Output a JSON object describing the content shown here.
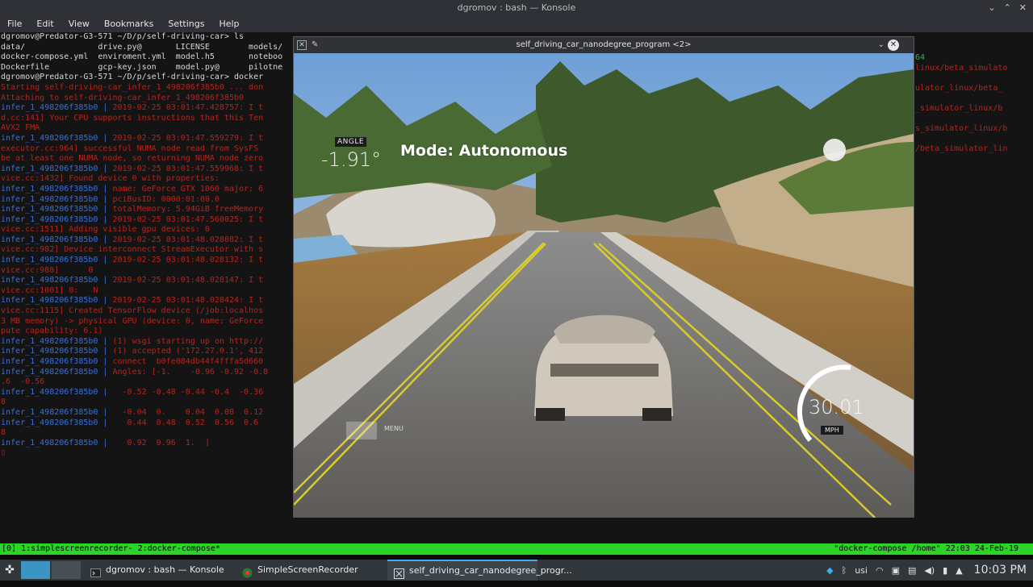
{
  "konsole": {
    "title": "dgromov : bash — Konsole",
    "menu": [
      "File",
      "Edit",
      "View",
      "Bookmarks",
      "Settings",
      "Help"
    ],
    "lines": [
      {
        "t": "dgromov@Predator-G3-571 ~/D/p/self-driving-car> ls",
        "c": "white"
      },
      {
        "t": "data/               drive.py@       LICENSE        models/",
        "c": "white"
      },
      {
        "t": "docker-compose.yml  enviroment.yml  model.h5       noteboo",
        "c": "white"
      },
      {
        "t": "Dockerfile          gcp-key.json    model.py@      pilotne",
        "c": "white"
      },
      {
        "t": "dgromov@Predator-G3-571 ~/D/p/self-driving-car> docker",
        "c": "white"
      },
      {
        "t": "Starting self-driving-car_infer_1_498206f385b0 ... don",
        "c": "red"
      },
      {
        "t": "Attaching to self-driving-car_infer_1_498206f385b0",
        "c": "red"
      },
      {
        "t": "infer_1_498206f385b0 | 2019-02-25 03:01:47.428757: I t",
        "c": "mix"
      },
      {
        "t": "d.cc:141] Your CPU supports instructions that this Ten",
        "c": "red"
      },
      {
        "t": "AVX2 FMA",
        "c": "red"
      },
      {
        "t": "infer_1_498206f385b0 | 2019-02-25 03:01:47.559279: I t",
        "c": "mix"
      },
      {
        "t": "executor.cc:964] successful NUMA node read from SysFS",
        "c": "red"
      },
      {
        "t": "be at least one NUMA node, so returning NUMA node zero",
        "c": "red"
      },
      {
        "t": "infer_1_498206f385b0 | 2019-02-25 03:01:47.559968: I t",
        "c": "mix"
      },
      {
        "t": "vice.cc:1432] Found device 0 with properties:",
        "c": "red"
      },
      {
        "t": "infer_1_498206f385b0 | name: GeForce GTX 1060 major: 6",
        "c": "mix"
      },
      {
        "t": "infer_1_498206f385b0 | pciBusID: 0000:01:00.0",
        "c": "mix"
      },
      {
        "t": "infer_1_498206f385b0 | totalMemory: 5.94GiB freeMemory",
        "c": "mix"
      },
      {
        "t": "infer_1_498206f385b0 | 2019-02-25 03:01:47.560025: I t",
        "c": "mix"
      },
      {
        "t": "vice.cc:1511] Adding visible gpu devices: 0",
        "c": "red"
      },
      {
        "t": "infer_1_498206f385b0 | 2019-02-25 03:01:48.028082: I t",
        "c": "mix"
      },
      {
        "t": "vice.cc:982] Device interconnect StreamExecutor with s",
        "c": "red"
      },
      {
        "t": "infer_1_498206f385b0 | 2019-02-25 03:01:48.028132: I t",
        "c": "mix"
      },
      {
        "t": "vice.cc:988]      0",
        "c": "red"
      },
      {
        "t": "infer_1_498206f385b0 | 2019-02-25 03:01:48.028147: I t",
        "c": "mix"
      },
      {
        "t": "vice.cc:1001] 0:   N",
        "c": "red"
      },
      {
        "t": "infer_1_498206f385b0 | 2019-02-25 03:01:48.028424: I t",
        "c": "mix"
      },
      {
        "t": "vice.cc:1115] Created TensorFlow device (/job:localhos",
        "c": "red"
      },
      {
        "t": "3 MB memory) -> physical GPU (device: 0, name: GeForce",
        "c": "red"
      },
      {
        "t": "pute capability: 6.1)",
        "c": "red"
      },
      {
        "t": "infer_1_498206f385b0 | (1) wsgi starting up on http://",
        "c": "mix"
      },
      {
        "t": "infer_1_498206f385b0 | (1) accepted ('172.27.0.1', 412",
        "c": "mix"
      },
      {
        "t": "infer_1_498206f385b0 | connect  b0fe084db44f4fffa5d660",
        "c": "mix"
      },
      {
        "t": "infer_1_498206f385b0 | Angles: [-1.    -0.96 -0.92 -0.8",
        "c": "mix"
      },
      {
        "t": ".6  -0.56",
        "c": "red"
      },
      {
        "t": "infer_1_498206f385b0 |   -0.52 -0.48 -0.44 -0.4  -0.36",
        "c": "mix"
      },
      {
        "t": "8",
        "c": "red"
      },
      {
        "t": "infer_1_498206f385b0 |   -0.04  0.    0.04  0.08  0.12",
        "c": "mix"
      },
      {
        "t": "infer_1_498206f385b0 |    0.44  0.48  0.52  0.56  0.6",
        "c": "mix"
      },
      {
        "t": "8",
        "c": "red"
      },
      {
        "t": "infer_1_498206f385b0 |    0.92  0.96  1.  ]",
        "c": "mix"
      },
      {
        "t": "▯",
        "c": "red"
      }
    ],
    "right_lines": [
      {
        "t": "64",
        "c": "g"
      },
      {
        "t": "linux/beta_simulato",
        "c": ""
      },
      {
        "t": "",
        "c": ""
      },
      {
        "t": "ulator_linux/beta_",
        "c": ""
      },
      {
        "t": "",
        "c": ""
      },
      {
        "t": "_simulator_linux/b",
        "c": ""
      },
      {
        "t": "",
        "c": ""
      },
      {
        "t": "s_simulator_linux/b",
        "c": ""
      },
      {
        "t": "",
        "c": ""
      },
      {
        "t": "/beta_simulator_lin",
        "c": ""
      }
    ]
  },
  "tmux": {
    "left": "[0] 1:simplescreenrecorder- 2:docker-compose*",
    "right": "\"docker-compose  /home\" 22:03 24-Feb-19"
  },
  "simulator": {
    "title": "self_driving_car_nanodegree_program <2>",
    "angle_label": "ANGLE",
    "angle_value": "-1.91°",
    "mode": "Mode: Autonomous",
    "speed_value": "30.01",
    "speed_unit": "MPH",
    "menu_label": "MENU"
  },
  "taskbar": {
    "tasks": [
      {
        "label": "dgromov : bash — Konsole"
      },
      {
        "label": "SimpleScreenRecorder"
      },
      {
        "label": "self_driving_car_nanodegree_progr..."
      }
    ],
    "keyboard_layout": "usi",
    "clock": "10:03 PM"
  },
  "colors": {
    "tmux_green": "#2bd427",
    "taskbar_bg": "#31363b",
    "accent": "#3daee9",
    "road_line_yellow": "#d8cc2a"
  }
}
